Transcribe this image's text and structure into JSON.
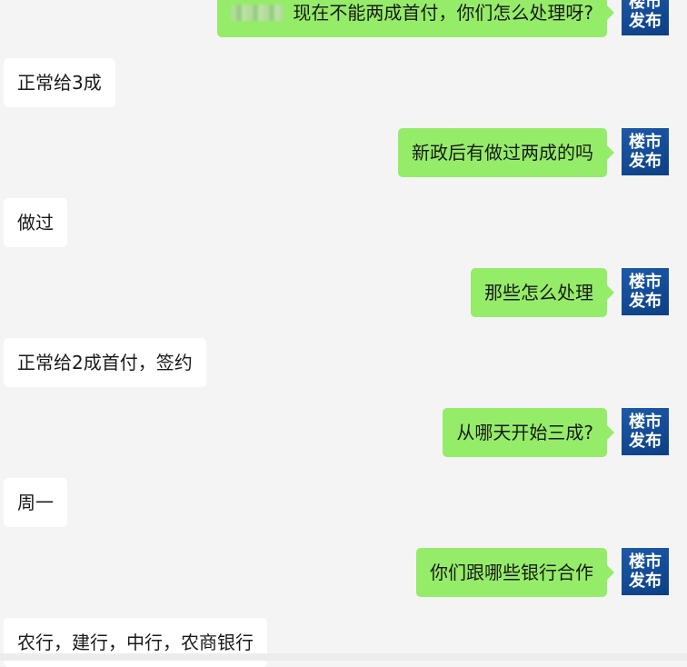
{
  "avatar": {
    "line1": "楼市",
    "line2": "发布"
  },
  "messages": [
    {
      "side": "out",
      "text": "现在不能两成首付，你们怎么处理呀?"
    },
    {
      "side": "in",
      "text": "正常给3成"
    },
    {
      "side": "out",
      "text": "新政后有做过两成的吗"
    },
    {
      "side": "in",
      "text": "做过"
    },
    {
      "side": "out",
      "text": "那些怎么处理"
    },
    {
      "side": "in",
      "text": "正常给2成首付，签约"
    },
    {
      "side": "out",
      "text": "从哪天开始三成?"
    },
    {
      "side": "in",
      "text": "周一"
    },
    {
      "side": "out",
      "text": "你们跟哪些银行合作"
    },
    {
      "side": "in",
      "text": "农行，建行，中行，农商银行"
    }
  ]
}
